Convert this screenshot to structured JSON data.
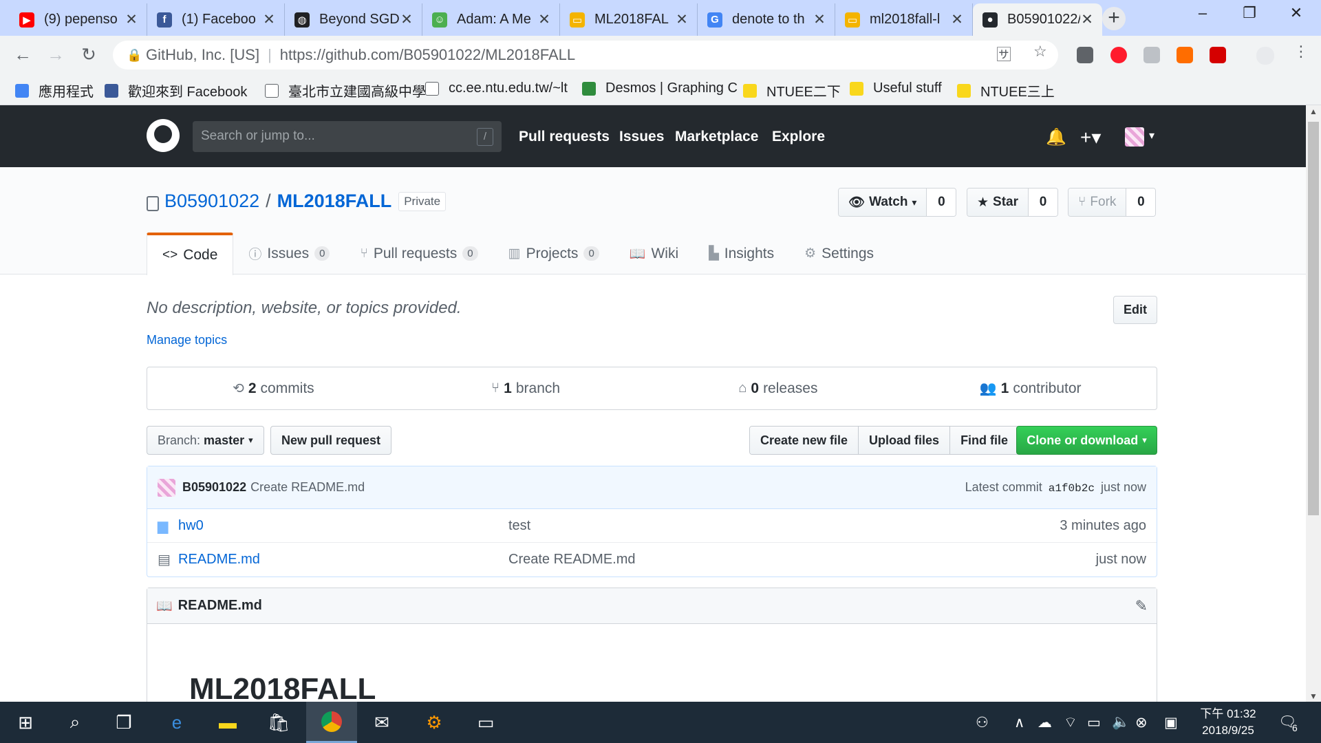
{
  "browser": {
    "tabs": [
      {
        "title": "(9) pepenso",
        "favicon": "youtube-icon",
        "color": "#ff0000"
      },
      {
        "title": "(1) Faceboo",
        "favicon": "facebook-icon",
        "color": "#3b5998"
      },
      {
        "title": "Beyond SGD",
        "favicon": "globe-icon",
        "color": "#202124"
      },
      {
        "title": "Adam: A Me",
        "favicon": "smiley-icon",
        "color": "#4caf50"
      },
      {
        "title": "ML2018FAL",
        "favicon": "slides-icon",
        "color": "#f4b400"
      },
      {
        "title": "denote to th",
        "favicon": "google-icon",
        "color": "#4285f4"
      },
      {
        "title": "ml2018fall-l",
        "favicon": "slides-icon",
        "color": "#f4b400"
      },
      {
        "title": "B05901022/",
        "favicon": "github-icon",
        "color": "#24292e"
      }
    ],
    "active_tab_index": 7,
    "omnibox": {
      "org": "GitHub, Inc. [US]",
      "url_prefix": "https://github.com/",
      "url_path": "B05901022/ML2018FALL"
    },
    "bookmarks": [
      {
        "label": "應用程式",
        "icon": "apps-icon",
        "color": "#4285f4"
      },
      {
        "label": "歡迎來到 Facebook",
        "icon": "facebook-icon",
        "color": "#3b5998"
      },
      {
        "label": "臺北市立建國高級中學",
        "icon": "page-icon",
        "color": "#ffffff"
      },
      {
        "label": "cc.ee.ntu.edu.tw/~lt",
        "icon": "page-icon",
        "color": "#ffffff"
      },
      {
        "label": "Desmos | Graphing C",
        "icon": "desmos-icon",
        "color": "#2f8c3d"
      },
      {
        "label": "NTUEE二下",
        "icon": "folder-icon",
        "color": "#f9d71c"
      },
      {
        "label": "Useful stuff",
        "icon": "folder-icon",
        "color": "#f9d71c"
      },
      {
        "label": "NTUEE三上",
        "icon": "folder-icon",
        "color": "#f9d71c"
      }
    ]
  },
  "github": {
    "search_placeholder": "Search or jump to...",
    "search_shortcut": "/",
    "nav": [
      "Pull requests",
      "Issues",
      "Marketplace",
      "Explore"
    ],
    "repo": {
      "owner": "B05901022",
      "name": "ML2018FALL",
      "visibility": "Private",
      "watch": {
        "label": "Watch",
        "count": "0"
      },
      "star": {
        "label": "Star",
        "count": "0"
      },
      "fork": {
        "label": "Fork",
        "count": "0"
      }
    },
    "reponav": [
      {
        "label": "Code",
        "icon": "code-icon",
        "counter": ""
      },
      {
        "label": "Issues",
        "icon": "issue-icon",
        "counter": "0"
      },
      {
        "label": "Pull requests",
        "icon": "pull-request-icon",
        "counter": "0"
      },
      {
        "label": "Projects",
        "icon": "project-icon",
        "counter": "0"
      },
      {
        "label": "Wiki",
        "icon": "book-icon",
        "counter": ""
      },
      {
        "label": "Insights",
        "icon": "graph-icon",
        "counter": ""
      },
      {
        "label": "Settings",
        "icon": "gear-icon",
        "counter": ""
      }
    ],
    "description": "No description, website, or topics provided.",
    "manage_topics": "Manage topics",
    "edit_label": "Edit",
    "summary": [
      {
        "num": "2",
        "label": "commits",
        "icon": "history-icon"
      },
      {
        "num": "1",
        "label": "branch",
        "icon": "branch-icon"
      },
      {
        "num": "0",
        "label": "releases",
        "icon": "tag-icon"
      },
      {
        "num": "1",
        "label": "contributor",
        "icon": "people-icon"
      }
    ],
    "branch": {
      "prefix": "Branch:",
      "name": "master"
    },
    "new_pull_request": "New pull request",
    "file_buttons": [
      "Create new file",
      "Upload files",
      "Find file"
    ],
    "clone_button": "Clone or download",
    "latest_commit": {
      "user": "B05901022",
      "message": "Create README.md",
      "prefix": "Latest commit",
      "sha": "a1f0b2c",
      "age": "just now"
    },
    "files": [
      {
        "name": "hw0",
        "type": "folder",
        "message": "test",
        "age": "3 minutes ago"
      },
      {
        "name": "README.md",
        "type": "file",
        "message": "Create README.md",
        "age": "just now"
      }
    ],
    "readme": {
      "filename": "README.md",
      "heading": "ML2018FALL"
    },
    "accent_color": "#e36209",
    "link_color": "#0366d6",
    "clone_color": "#28a745"
  },
  "taskbar": {
    "clock_time": "下午 01:32",
    "clock_date": "2018/9/25",
    "notification_count": "6"
  }
}
